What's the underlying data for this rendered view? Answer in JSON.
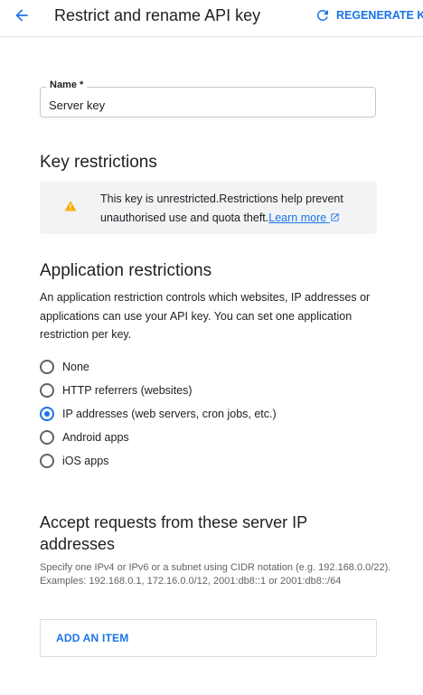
{
  "header": {
    "title": "Restrict and rename API key",
    "regenerate_label": "REGENERATE KEY"
  },
  "name_field": {
    "label": "Name *",
    "value": "Server key"
  },
  "key_restrictions": {
    "heading": "Key restrictions",
    "warning_text": "This key is unrestricted.Restrictions help prevent unauthorised use and quota theft.",
    "learn_more": "Learn more"
  },
  "application_restrictions": {
    "heading": "Application restrictions",
    "description": "An application restriction controls which websites, IP addresses or applications can use your API key. You can set one application restriction per key.",
    "options": [
      {
        "label": "None",
        "selected": false
      },
      {
        "label": "HTTP referrers (websites)",
        "selected": false
      },
      {
        "label": "IP addresses (web servers, cron jobs, etc.)",
        "selected": true
      },
      {
        "label": "Android apps",
        "selected": false
      },
      {
        "label": "iOS apps",
        "selected": false
      }
    ]
  },
  "ip_section": {
    "heading": "Accept requests from these server IP addresses",
    "hint_line1": "Specify one IPv4 or IPv6 or a subnet using CIDR notation (e.g. 192.168.0.0/22).",
    "hint_line2": "Examples: 192.168.0.1, 172.16.0.0/12, 2001:db8::1 or 2001:db8::/64",
    "add_button": "ADD AN ITEM"
  },
  "colors": {
    "accent": "#1a73e8",
    "warning": "#f9ab00",
    "warning_bg": "#f1f3f4"
  }
}
